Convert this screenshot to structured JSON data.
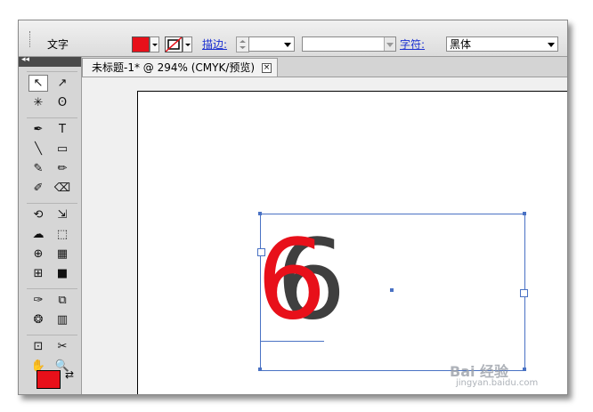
{
  "control_bar": {
    "tool_label": "文字",
    "stroke_label": "描边:",
    "stroke_value": "",
    "style_value": "",
    "font_label": "字符:",
    "font_value": "黑体"
  },
  "tools_header": "◂◂",
  "document_tab": {
    "title": "未标题-1* @ 294% (CMYK/预览)",
    "close_glyph": "×"
  },
  "artwork": {
    "glyph_front": "6",
    "glyph_back": "6"
  },
  "colors": {
    "fill": "#e8101a",
    "text_front": "#e8101a",
    "text_back": "#3f3f3f",
    "selection": "#4a72c4"
  },
  "tools": [
    "selection-tool",
    "direct-selection-tool",
    "magic-wand-tool",
    "lasso-tool",
    "pen-tool",
    "type-tool",
    "line-tool",
    "rectangle-tool",
    "paintbrush-tool",
    "pencil-tool",
    "blob-brush-tool",
    "eraser-tool",
    "rotate-tool",
    "scale-tool",
    "warp-tool",
    "free-transform-tool",
    "shape-builder-tool",
    "perspective-grid-tool",
    "mesh-tool",
    "gradient-tool",
    "eyedropper-tool",
    "blend-tool",
    "symbol-sprayer-tool",
    "column-graph-tool",
    "artboard-tool",
    "slice-tool",
    "hand-tool",
    "zoom-tool"
  ],
  "tool_icons": [
    "↖",
    "↗",
    "✳",
    "ʘ",
    "✒",
    "T",
    "╲",
    "▭",
    "✎",
    "✏",
    "✐",
    "⌫",
    "⟲",
    "⇲",
    "☁",
    "⬚",
    "⊕",
    "▦",
    "⊞",
    "■",
    "✑",
    "⧉",
    "❂",
    "▥",
    "⊡",
    "✂",
    "✋",
    "🔍"
  ],
  "watermark": {
    "brand": "Bai 经验",
    "url": "jingyan.baidu.com"
  }
}
